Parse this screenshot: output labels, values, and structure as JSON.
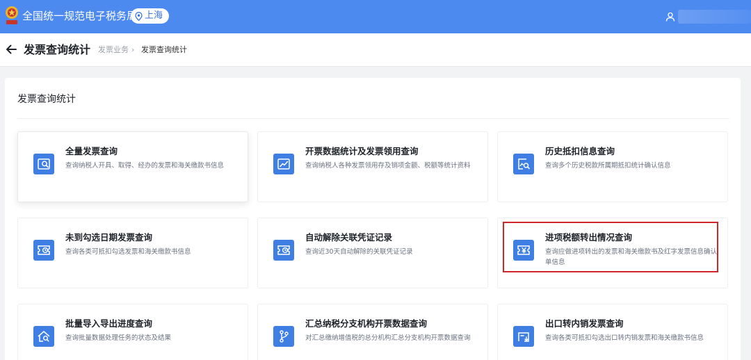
{
  "topbar": {
    "app_title": "全国统一规范电子税务局",
    "region": "上海"
  },
  "subheader": {
    "page_title": "发票查询统计",
    "breadcrumb": [
      "发票业务",
      "›",
      "发票查询统计"
    ]
  },
  "panel": {
    "title": "发票查询统计"
  },
  "cards": [
    {
      "title": "全量发票查询",
      "desc": "查询纳税人开具、取得、经办的发票和海关缴款书信息",
      "icon": "search-document-icon"
    },
    {
      "title": "开票数据统计及发票领用查询",
      "desc": "查询纳税人各种发票领用存及销项金额、税额等统计资料",
      "icon": "chart-document-icon"
    },
    {
      "title": "历史抵扣信息查询",
      "desc": "查询多个历史税款所属期抵扣统计确认信息",
      "icon": "image-search-icon"
    },
    {
      "title": "未到勾选日期发票查询",
      "desc": "查询各类可抵扣勾选发票和海关缴款书信息",
      "icon": "ticket-clock-icon"
    },
    {
      "title": "自动解除关联凭证记录",
      "desc": "查询近30天自动解除的关联凭证记录",
      "icon": "ticket-clock-icon"
    },
    {
      "title": "进项税额转出情况查询",
      "desc": "查询应做进项转出的发票和海关缴款书及红字发票信息确认单信息",
      "icon": "yen-ticket-icon"
    },
    {
      "title": "批量导入导出进度查询",
      "desc": "查询批量数据处理任务的状态及结果",
      "icon": "home-search-icon"
    },
    {
      "title": "汇总纳税分支机构开票数据查询",
      "desc": "对汇总缴纳增值税的总分机构汇总分支机构开票数据查询",
      "icon": "branch-icon"
    },
    {
      "title": "出口转内销发票查询",
      "desc": "查询各类可抵扣勾选出口转内销发票和海关缴款书信息",
      "icon": "export-document-icon"
    }
  ],
  "colors": {
    "topbar": "#4d8af0",
    "icon_bg": "#3f7fe4",
    "highlight": "#d0262b"
  }
}
